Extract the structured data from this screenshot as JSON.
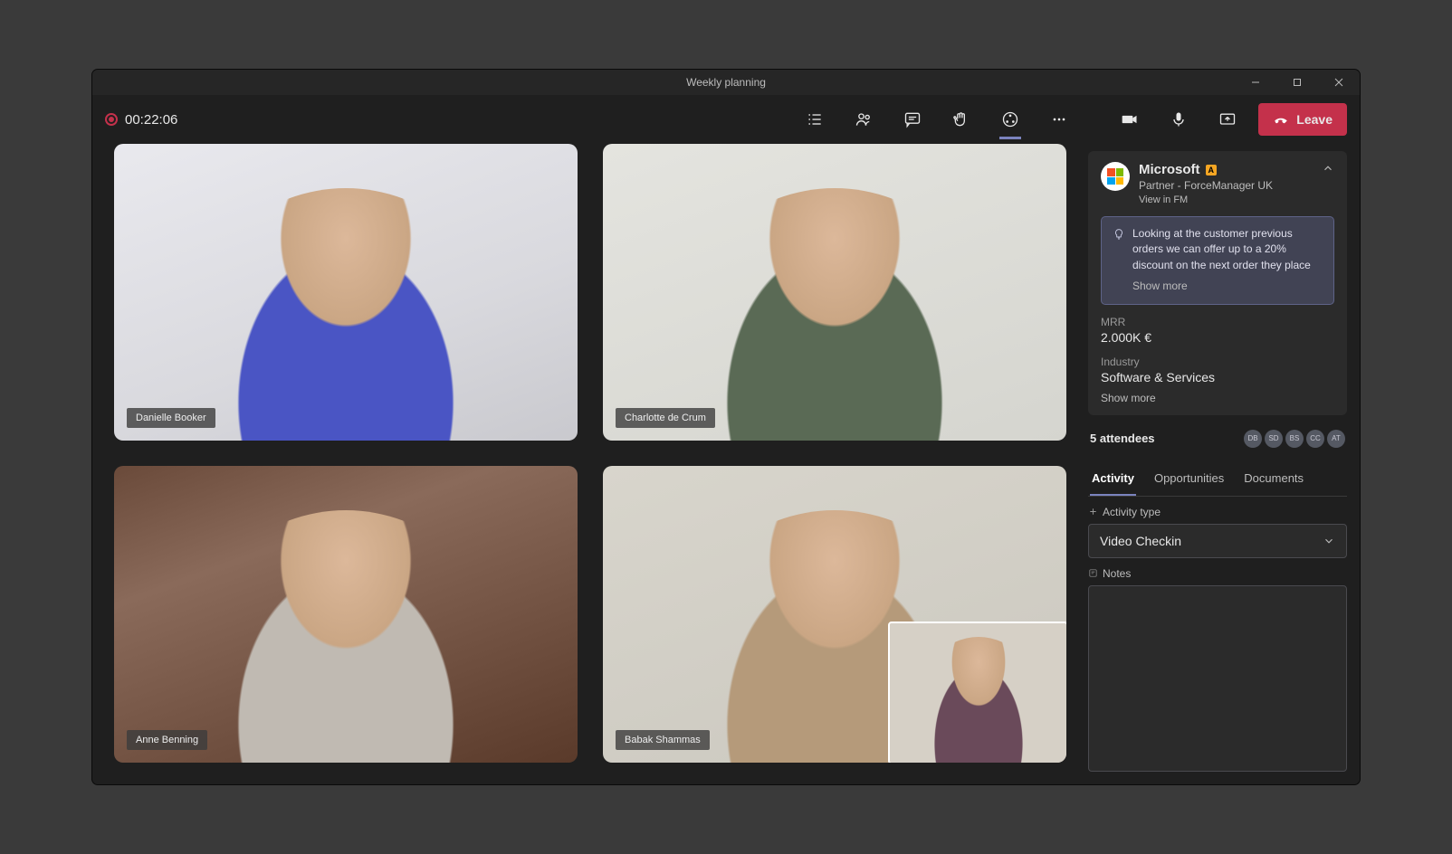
{
  "window": {
    "title": "Weekly planning"
  },
  "call": {
    "timer": "00:22:06",
    "leave_label": "Leave"
  },
  "participants": [
    {
      "name": "Danielle Booker"
    },
    {
      "name": "Charlotte de Crum"
    },
    {
      "name": "Anne Benning"
    },
    {
      "name": "Babak Shammas"
    }
  ],
  "sidebar": {
    "company": {
      "name": "Microsoft",
      "badge": "A",
      "subtitle": "Partner - ForceManager UK",
      "view_link": "View in FM"
    },
    "insight": {
      "text": "Looking at the customer previous orders we can offer up to a 20% discount on the next order they place",
      "show_more": "Show more"
    },
    "metrics": {
      "mrr_label": "MRR",
      "mrr_value": "2.000K €",
      "industry_label": "Industry",
      "industry_value": "Software & Services",
      "show_more": "Show more"
    },
    "attendees": {
      "label": "5 attendees",
      "initials": [
        "DB",
        "SD",
        "BS",
        "CC",
        "AT"
      ]
    },
    "tabs": {
      "items": [
        "Activity",
        "Opportunities",
        "Documents"
      ],
      "active_index": 0
    },
    "activity": {
      "type_label": "Activity type",
      "type_value": "Video Checkin",
      "notes_label": "Notes"
    }
  }
}
